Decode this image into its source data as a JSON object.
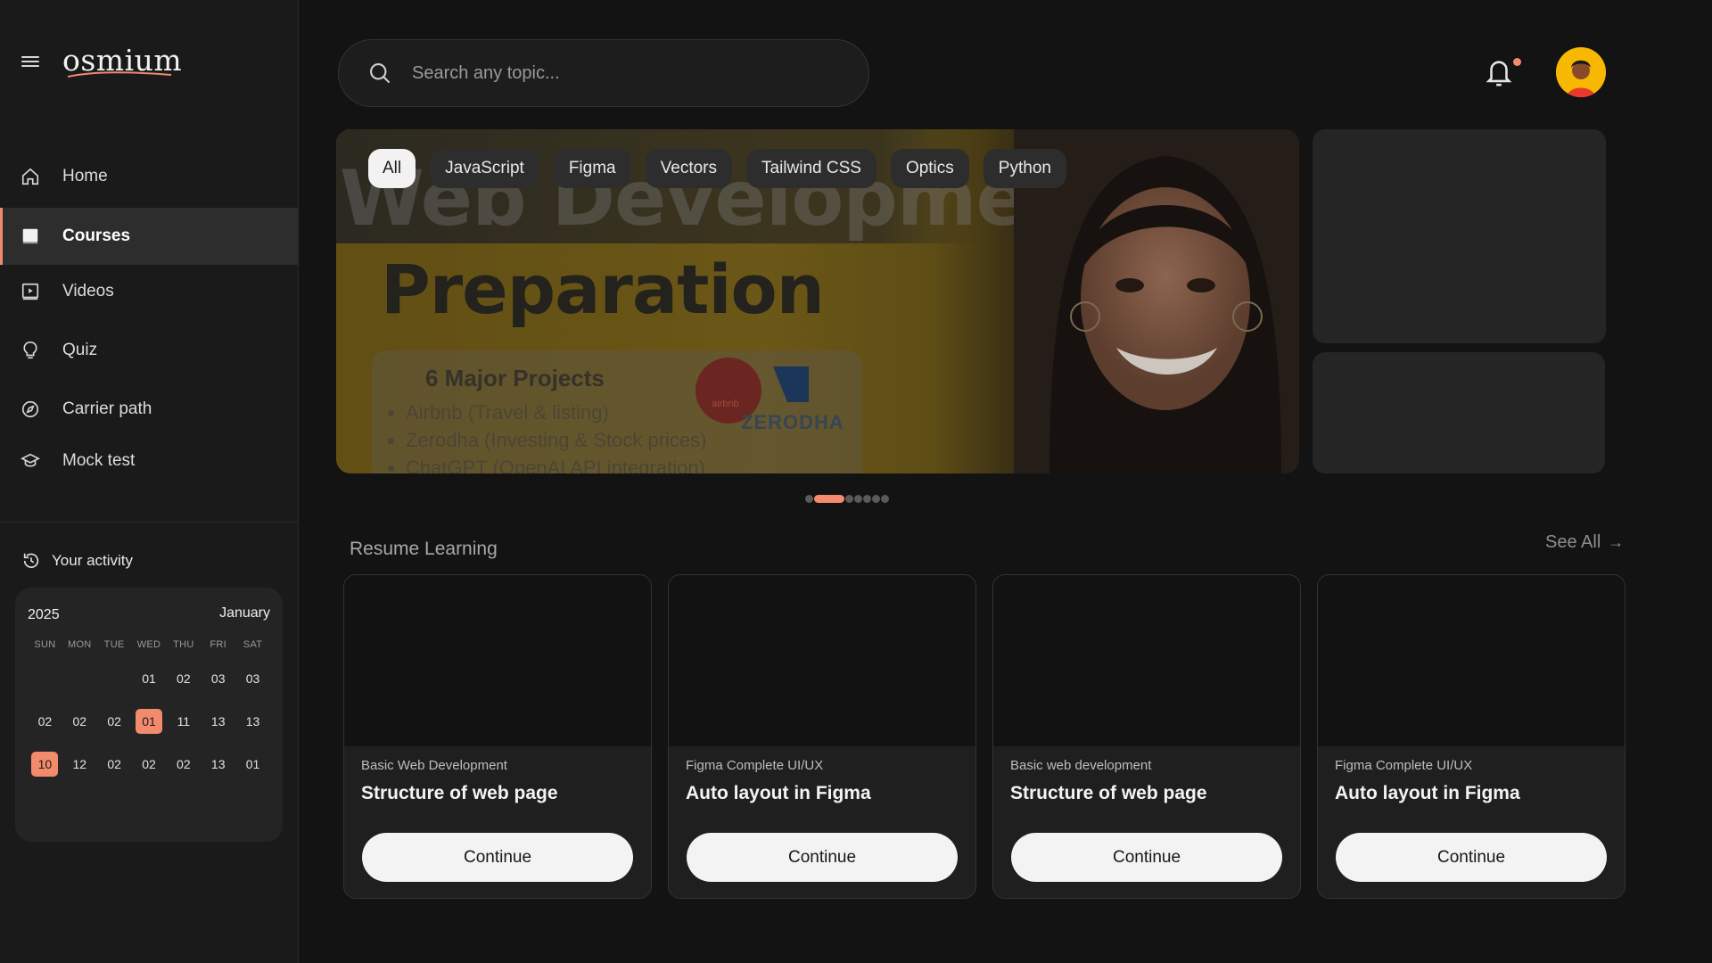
{
  "app": {
    "logo": "osmium"
  },
  "sidebar": {
    "items": [
      {
        "label": "Home",
        "icon": "home-icon"
      },
      {
        "label": "Courses",
        "icon": "book-icon",
        "active": true
      },
      {
        "label": "Videos",
        "icon": "video-icon"
      },
      {
        "label": "Quiz",
        "icon": "lightbulb-icon"
      },
      {
        "label": "Carrier path",
        "icon": "compass-icon"
      },
      {
        "label": "Mock test",
        "icon": "graduation-cap-icon"
      }
    ],
    "activity_label": "Your activity"
  },
  "calendar": {
    "year": "2025",
    "month": "January",
    "weekdays": [
      "SUN",
      "MON",
      "TUE",
      "WED",
      "THU",
      "FRI",
      "SAT"
    ],
    "rows": [
      [
        "",
        "",
        "",
        "01",
        "02",
        "03",
        "03"
      ],
      [
        "02",
        "02",
        "02",
        "01",
        "11",
        "13",
        "13"
      ],
      [
        "10",
        "12",
        "02",
        "02",
        "02",
        "13",
        "01"
      ]
    ],
    "highlighted": [
      [
        1,
        3
      ],
      [
        2,
        0
      ]
    ],
    "highlight_color": "#f28b6c"
  },
  "search": {
    "placeholder": "Search any topic..."
  },
  "hero": {
    "title_line1": "Web Development",
    "title_line2": "Preparation",
    "card_title": "6 Major Projects",
    "bullets": [
      "Airbnb (Travel & listing)",
      "Zerodha (Investing & Stock prices)",
      "ChatGPT (OpenAI API integration)"
    ],
    "logo_text": "ZERODHA",
    "airbnb_text": "airbnb"
  },
  "chips": [
    "All",
    "JavaScript",
    "Figma",
    "Vectors",
    "Tailwind CSS",
    "Optics",
    "Python"
  ],
  "carousel": {
    "count": 7,
    "active_index": 1
  },
  "resume": {
    "title": "Resume Learning",
    "see_all": "See All",
    "cards": [
      {
        "category": "Basic Web Development",
        "title": "Structure of web page",
        "button": "Continue"
      },
      {
        "category": "Figma Complete UI/UX",
        "title": "Auto layout in Figma",
        "button": "Continue"
      },
      {
        "category": "Basic web development",
        "title": "Structure of web page",
        "button": "Continue"
      },
      {
        "category": "Figma Complete UI/UX",
        "title": "Auto layout in Figma",
        "button": "Continue"
      }
    ]
  },
  "colors": {
    "accent": "#f48b6e",
    "background": "#131313",
    "sidebar": "#1a1a1a"
  }
}
